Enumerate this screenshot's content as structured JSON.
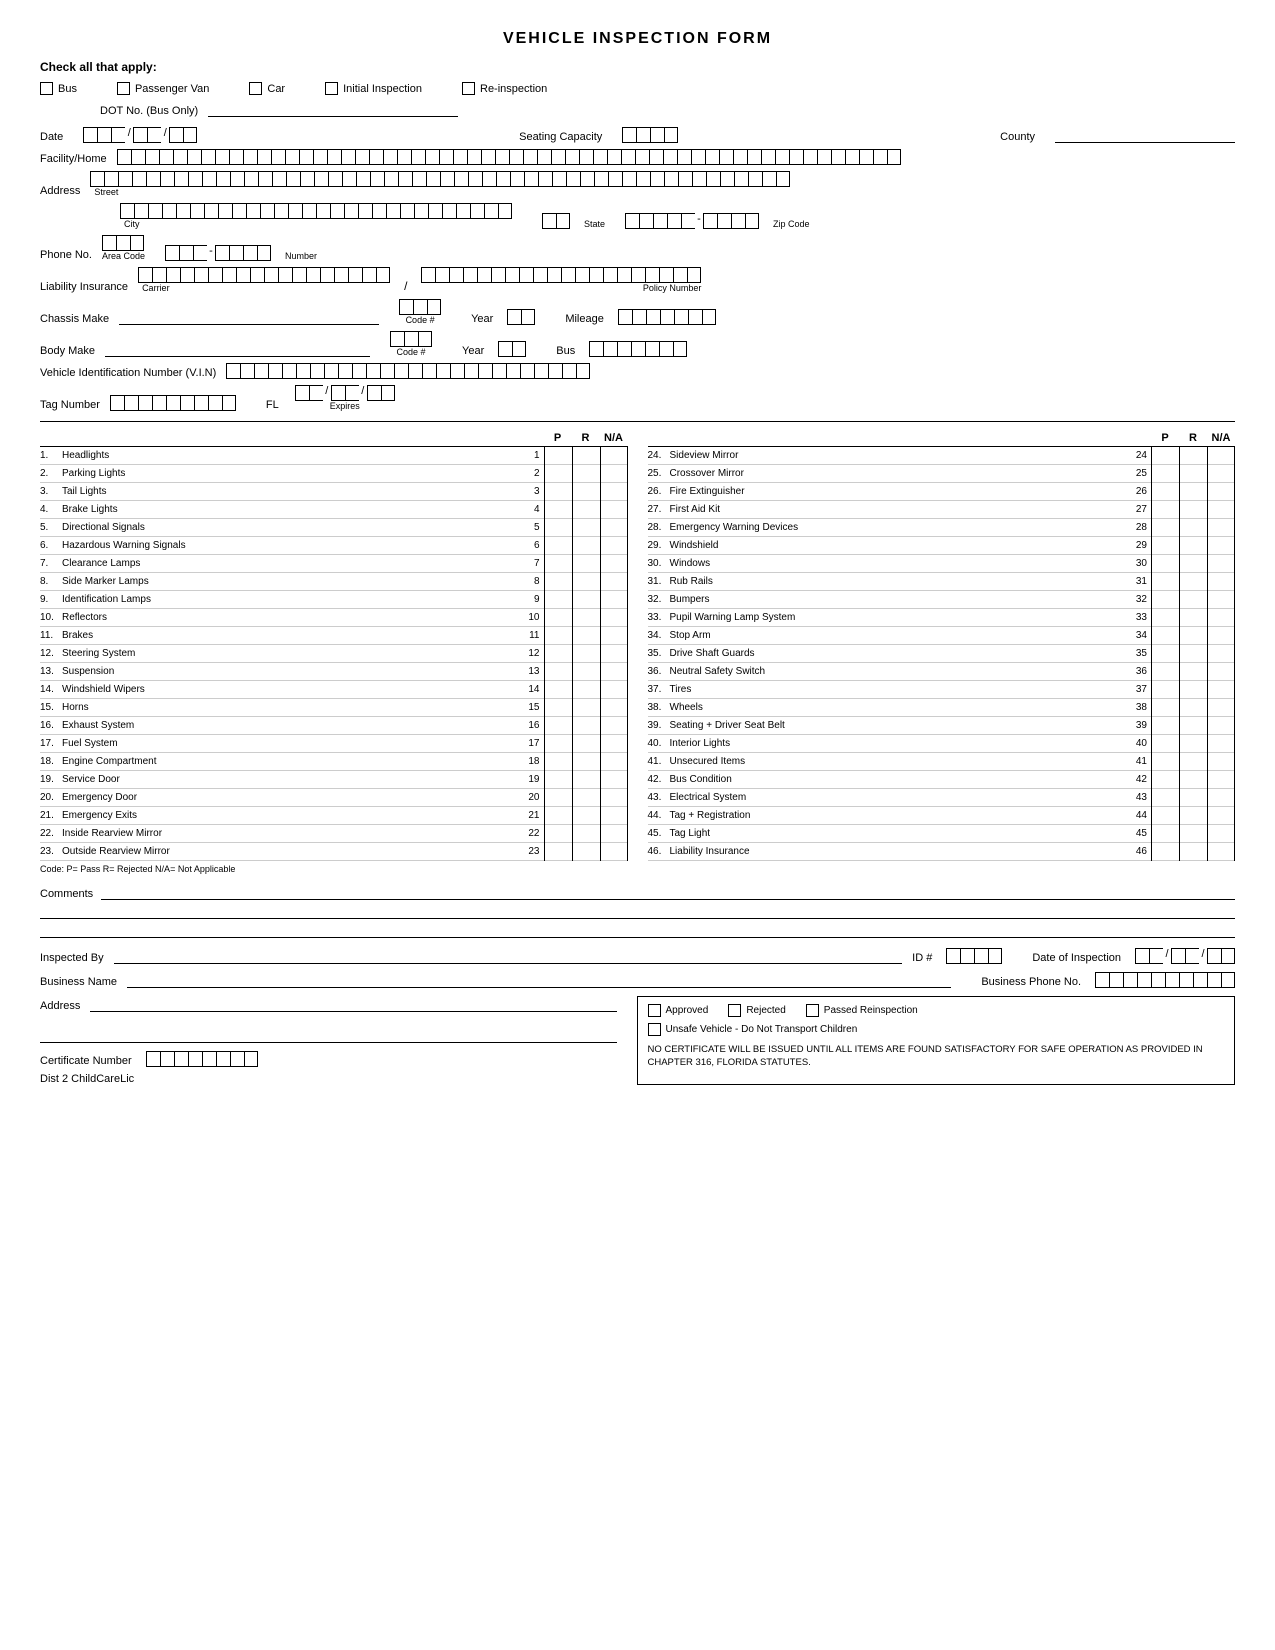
{
  "title": "VEHICLE INSPECTION FORM",
  "check_all_label": "Check all that apply:",
  "vehicle_types": [
    {
      "label": "Bus"
    },
    {
      "label": "Passenger Van"
    },
    {
      "label": "Car"
    },
    {
      "label": "Initial Inspection"
    },
    {
      "label": "Re-inspection"
    }
  ],
  "dot_label": "DOT No. (Bus Only)",
  "fields": {
    "date_label": "Date",
    "seating_label": "Seating Capacity",
    "county_label": "County",
    "facility_label": "Facility/Home",
    "address_label": "Address",
    "street_label": "Street",
    "city_label": "City",
    "state_label": "State",
    "zip_label": "Zip Code",
    "phone_label": "Phone No.",
    "area_code_label": "Area Code",
    "number_label": "Number",
    "liability_label": "Liability Insurance",
    "carrier_label": "Carrier",
    "policy_label": "Policy Number",
    "chassis_label": "Chassis Make",
    "code_label": "Code #",
    "year_label": "Year",
    "mileage_label": "Mileage",
    "body_label": "Body Make",
    "vin_label": "Vehicle Identification Number (V.I.N)",
    "tag_label": "Tag Number",
    "fl_label": "FL",
    "expires_label": "Expires"
  },
  "table_headers": {
    "p": "P",
    "r": "R",
    "na": "N/A"
  },
  "left_items": [
    {
      "num": "1.",
      "name": "Headlights",
      "id": "1"
    },
    {
      "num": "2.",
      "name": "Parking Lights",
      "id": "2"
    },
    {
      "num": "3.",
      "name": "Tail Lights",
      "id": "3"
    },
    {
      "num": "4.",
      "name": "Brake Lights",
      "id": "4"
    },
    {
      "num": "5.",
      "name": "Directional Signals",
      "id": "5"
    },
    {
      "num": "6.",
      "name": "Hazardous Warning Signals",
      "id": "6"
    },
    {
      "num": "7.",
      "name": "Clearance Lamps",
      "id": "7"
    },
    {
      "num": "8.",
      "name": "Side Marker Lamps",
      "id": "8"
    },
    {
      "num": "9.",
      "name": "Identification Lamps",
      "id": "9"
    },
    {
      "num": "10.",
      "name": "Reflectors",
      "id": "10"
    },
    {
      "num": "11.",
      "name": "Brakes",
      "id": "11"
    },
    {
      "num": "12.",
      "name": "Steering System",
      "id": "12"
    },
    {
      "num": "13.",
      "name": "Suspension",
      "id": "13"
    },
    {
      "num": "14.",
      "name": "Windshield Wipers",
      "id": "14"
    },
    {
      "num": "15.",
      "name": "Horns",
      "id": "15"
    },
    {
      "num": "16.",
      "name": "Exhaust System",
      "id": "16"
    },
    {
      "num": "17.",
      "name": "Fuel System",
      "id": "17"
    },
    {
      "num": "18.",
      "name": "Engine Compartment",
      "id": "18"
    },
    {
      "num": "19.",
      "name": "Service Door",
      "id": "19"
    },
    {
      "num": "20.",
      "name": "Emergency Door",
      "id": "20"
    },
    {
      "num": "21.",
      "name": "Emergency Exits",
      "id": "21"
    },
    {
      "num": "22.",
      "name": "Inside Rearview Mirror",
      "id": "22"
    },
    {
      "num": "23.",
      "name": "Outside Rearview Mirror",
      "id": "23"
    }
  ],
  "right_items": [
    {
      "num": "24.",
      "name": "Sideview Mirror",
      "id": "24"
    },
    {
      "num": "25.",
      "name": "Crossover Mirror",
      "id": "25"
    },
    {
      "num": "26.",
      "name": "Fire Extinguisher",
      "id": "26"
    },
    {
      "num": "27.",
      "name": "First Aid Kit",
      "id": "27"
    },
    {
      "num": "28.",
      "name": "Emergency Warning Devices",
      "id": "28"
    },
    {
      "num": "29.",
      "name": "Windshield",
      "id": "29"
    },
    {
      "num": "30.",
      "name": "Windows",
      "id": "30"
    },
    {
      "num": "31.",
      "name": "Rub Rails",
      "id": "31"
    },
    {
      "num": "32.",
      "name": "Bumpers",
      "id": "32"
    },
    {
      "num": "33.",
      "name": "Pupil Warning Lamp System",
      "id": "33"
    },
    {
      "num": "34.",
      "name": "Stop Arm",
      "id": "34"
    },
    {
      "num": "35.",
      "name": "Drive Shaft Guards",
      "id": "35"
    },
    {
      "num": "36.",
      "name": "Neutral Safety Switch",
      "id": "36"
    },
    {
      "num": "37.",
      "name": "Tires",
      "id": "37"
    },
    {
      "num": "38.",
      "name": "Wheels",
      "id": "38"
    },
    {
      "num": "39.",
      "name": "Seating + Driver Seat Belt",
      "id": "39"
    },
    {
      "num": "40.",
      "name": "Interior Lights",
      "id": "40"
    },
    {
      "num": "41.",
      "name": "Unsecured Items",
      "id": "41"
    },
    {
      "num": "42.",
      "name": "Bus Condition",
      "id": "42"
    },
    {
      "num": "43.",
      "name": "Electrical System",
      "id": "43"
    },
    {
      "num": "44.",
      "name": "Tag + Registration",
      "id": "44"
    },
    {
      "num": "45.",
      "name": "Tag Light",
      "id": "45"
    },
    {
      "num": "46.",
      "name": "Liability Insurance",
      "id": "46"
    }
  ],
  "code_legend": "Code:  P= Pass  R= Rejected  N/A= Not Applicable",
  "comments_label": "Comments",
  "bottom": {
    "inspected_by_label": "Inspected By",
    "id_label": "ID #",
    "date_of_inspection_label": "Date of Inspection",
    "business_name_label": "Business Name",
    "business_phone_label": "Business Phone No.",
    "address_label": "Address",
    "approved_label": "Approved",
    "rejected_label": "Rejected",
    "passed_reinspection_label": "Passed Reinspection",
    "unsafe_label": "Unsafe Vehicle - Do Not Transport Children",
    "notice": "NO CERTIFICATE WILL BE ISSUED UNTIL ALL ITEMS ARE FOUND SATISFACTORY FOR SAFE OPERATION AS PROVIDED IN CHAPTER 316, FLORIDA STATUTES.",
    "cert_label": "Certificate Number",
    "dist_label": "Dist 2 ChildCareLic"
  }
}
